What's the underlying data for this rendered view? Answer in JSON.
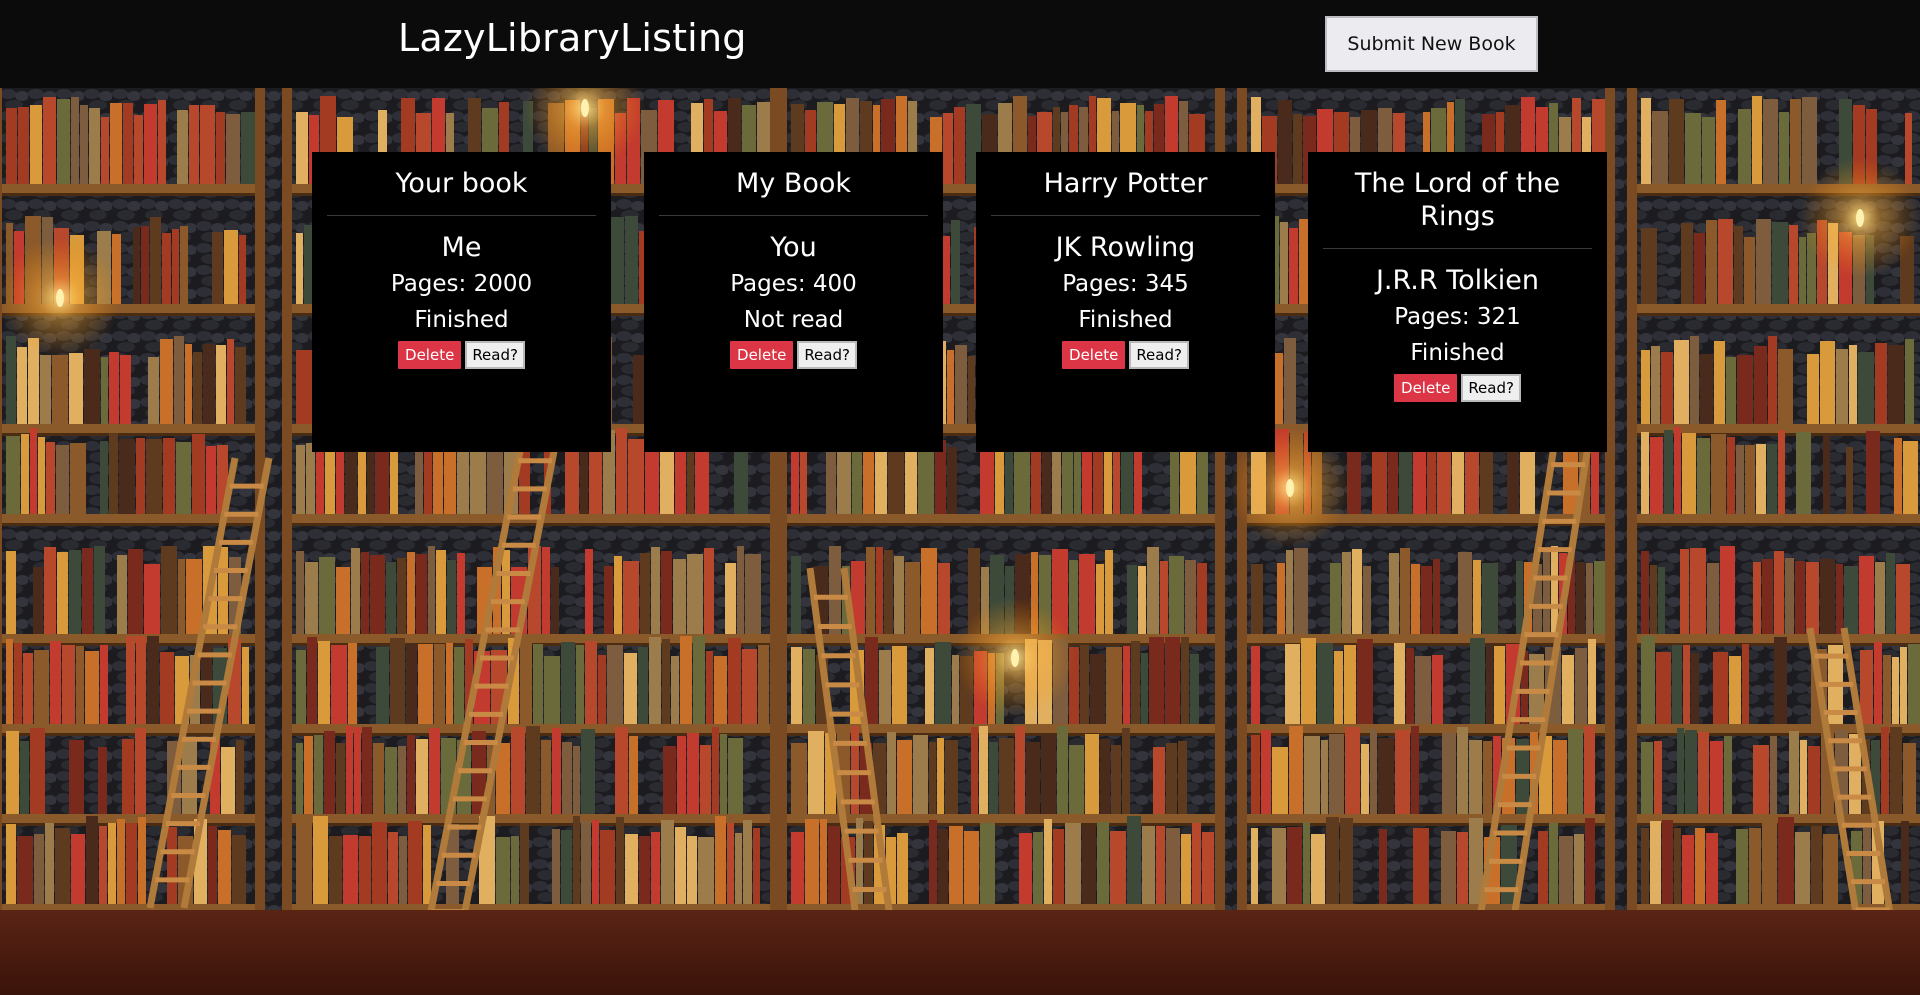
{
  "header": {
    "brand": "LazyLibraryListing",
    "submit_label": "Submit New Book"
  },
  "books": [
    {
      "title": "Your book",
      "author": "Me",
      "pages": "Pages: 2000",
      "status": "Finished",
      "delete_label": "Delete",
      "read_label": "Read?"
    },
    {
      "title": "My Book",
      "author": "You",
      "pages": "Pages: 400",
      "status": "Not read",
      "delete_label": "Delete",
      "read_label": "Read?"
    },
    {
      "title": "Harry Potter",
      "author": "JK Rowling",
      "pages": "Pages: 345",
      "status": "Finished",
      "delete_label": "Delete",
      "read_label": "Read?"
    },
    {
      "title": "The Lord of the Rings",
      "author": "J.R.R Tolkien",
      "pages": "Pages: 321",
      "status": "Finished",
      "delete_label": "Delete",
      "read_label": "Read?"
    }
  ],
  "theme": {
    "header_bg": "#0b0b0b",
    "card_bg": "#000000",
    "delete_color": "#dc3545",
    "read_bg": "#efefef"
  },
  "background_image": "library-bookshelves-with-ladders"
}
